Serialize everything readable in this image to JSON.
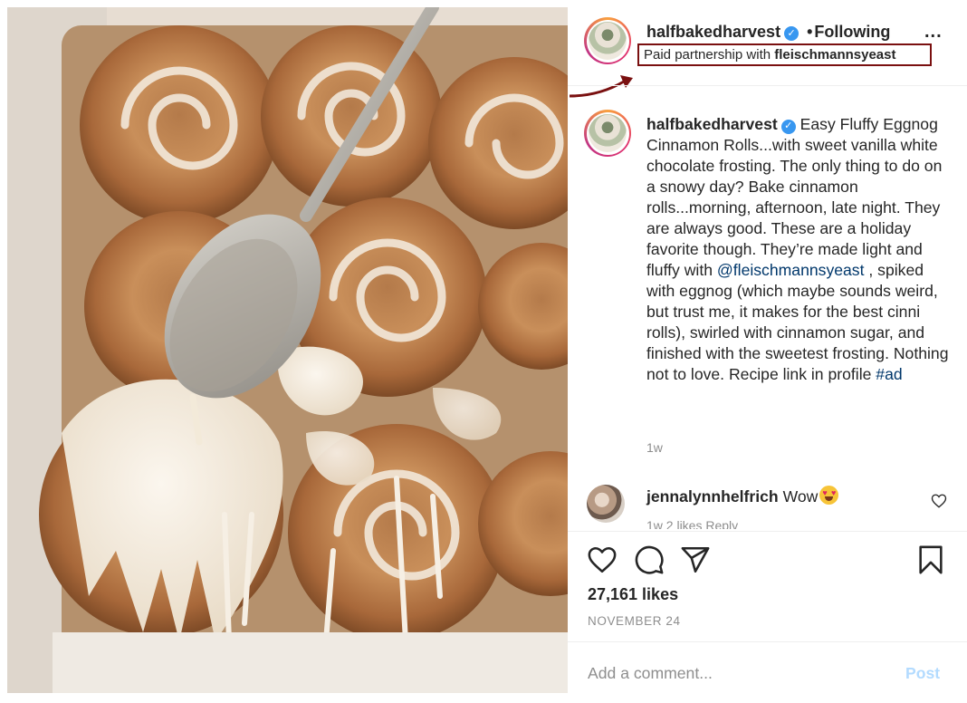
{
  "post": {
    "username": "halfbakedharvest",
    "verified_mark": "✓",
    "follow_separator": "•",
    "follow_status": "Following",
    "more_options": "...",
    "partnership_prefix": "Paid partnership with",
    "partner": "fleischmannsyeast"
  },
  "caption": {
    "username": "halfbakedharvest",
    "text_part1": "Easy Fluffy Eggnog Cinnamon Rolls...with sweet vanilla white chocolate frosting. The only thing to do on a snowy day? Bake cinnamon rolls...morning, afternoon, late night. They are always good. These are a holiday favorite though. They’re made light and fluffy with",
    "mention": "@fleischmannsyeast",
    "text_part2": ", spiked with eggnog (which maybe sounds weird, but trust me, it makes for the best cinni rolls), swirled with cinnamon sugar, and finished with the sweetest frosting. Nothing not to love. Recipe link in profile",
    "hashtag": "#ad",
    "time_ago": "1w"
  },
  "comment": {
    "username": "jennalynnhelfrich",
    "text": "Wow",
    "emoji": "heart-eyes-emoji",
    "meta": "1w   2 likes   Reply"
  },
  "actions": {
    "likes": "27,161 likes",
    "date": "NOVEMBER 24"
  },
  "comment_box": {
    "placeholder": "Add a comment...",
    "post_label": "Post"
  },
  "icons": {
    "like": "heart-icon",
    "comment": "comment-bubble-icon",
    "share": "paper-plane-icon",
    "save": "bookmark-icon"
  },
  "colors": {
    "highlight_box": "#7a1010",
    "link": "#00376b",
    "verified": "#3897f0",
    "post_button_disabled": "#b3dbff",
    "muted_text": "#8e8e8e"
  }
}
